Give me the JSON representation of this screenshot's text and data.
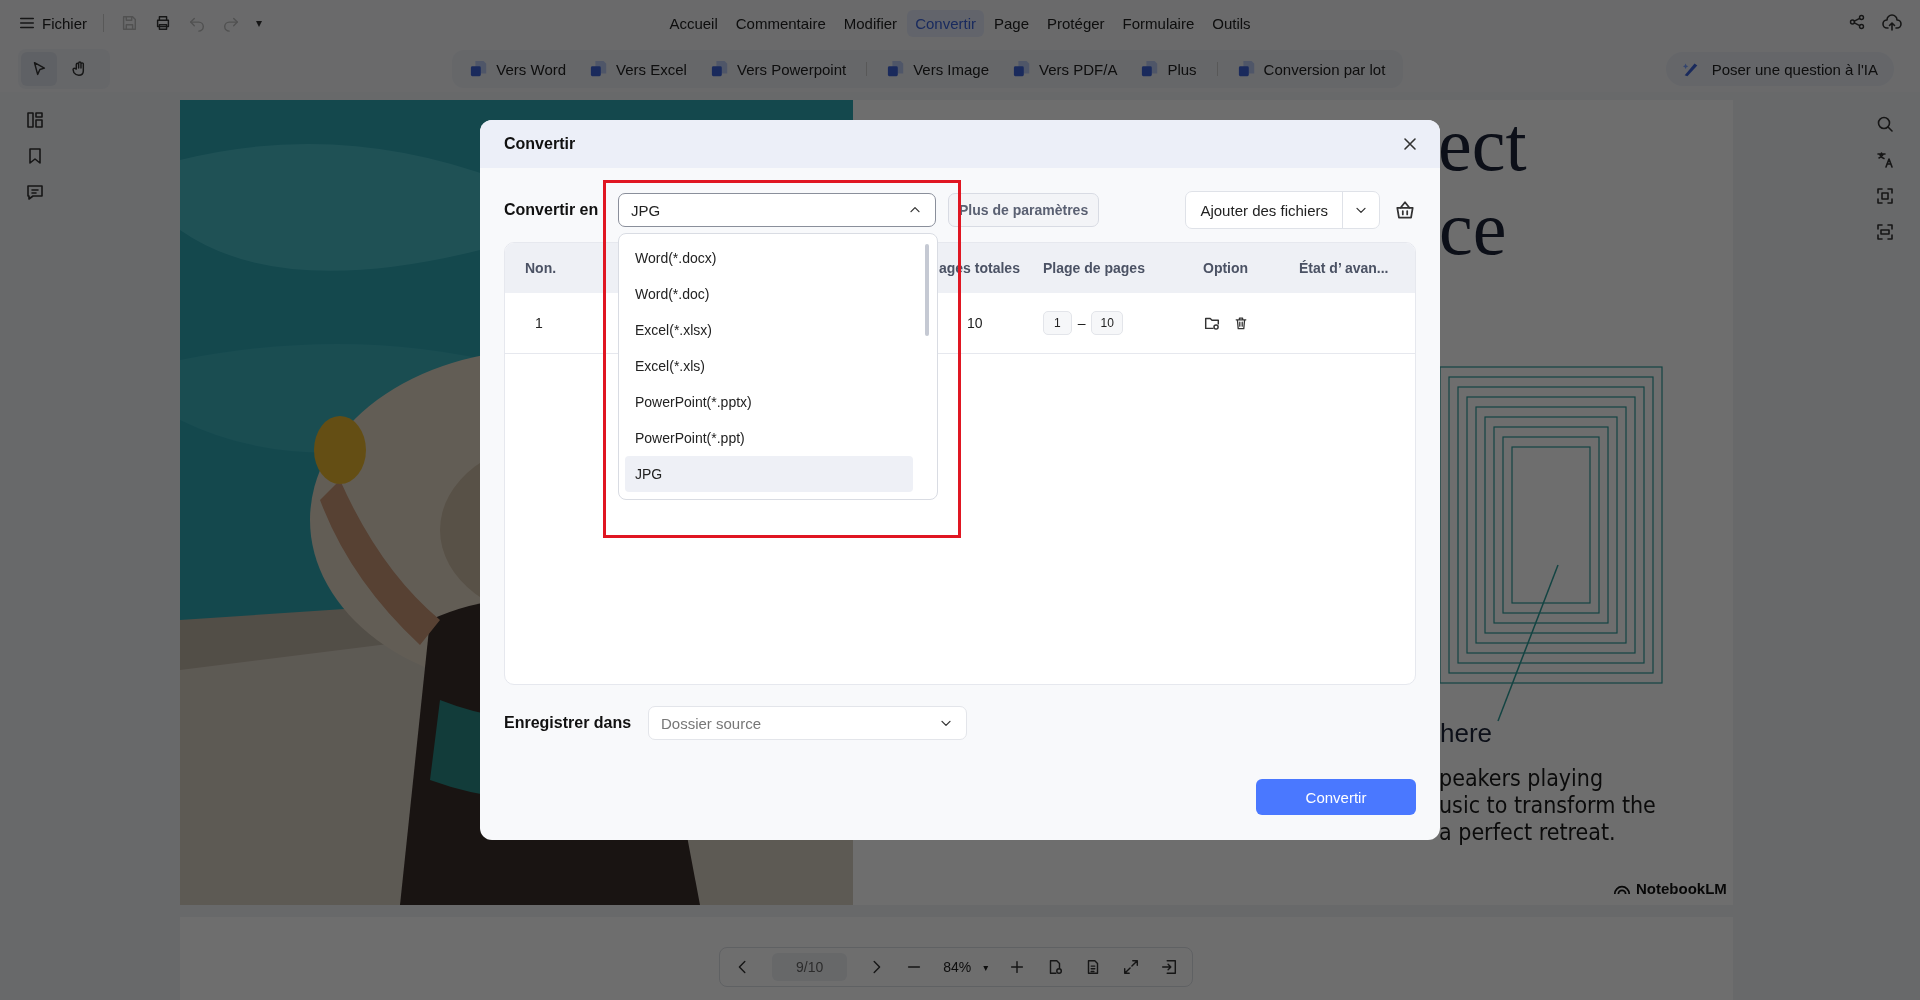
{
  "menu_bar": {
    "file_menu": "Fichier",
    "more_caret": "▾",
    "tabs": [
      {
        "label": "Accueil",
        "selected": false
      },
      {
        "label": "Commentaire",
        "selected": false
      },
      {
        "label": "Modifier",
        "selected": false
      },
      {
        "label": "Convertir",
        "selected": true
      },
      {
        "label": "Page",
        "selected": false
      },
      {
        "label": "Protéger",
        "selected": false
      },
      {
        "label": "Formulaire",
        "selected": false
      },
      {
        "label": "Outils",
        "selected": false
      }
    ]
  },
  "toolbar": {
    "conversions": [
      {
        "label": "Vers Word",
        "group_end": false
      },
      {
        "label": "Vers Excel",
        "group_end": false
      },
      {
        "label": "Vers Powerpoint",
        "group_end": true
      },
      {
        "label": "Vers Image",
        "group_end": false
      },
      {
        "label": "Vers PDF/A",
        "group_end": false
      },
      {
        "label": "Plus",
        "group_end": true
      },
      {
        "label": "Conversion par lot",
        "group_end": false
      }
    ],
    "ai_button": "Poser une question à l'IA"
  },
  "document": {
    "photo": {
      "kind": "picture"
    },
    "heading_fragments": [
      "ect",
      "ce"
    ],
    "subheading": "here",
    "body_lines": [
      "peakers playing",
      "usic to transform the",
      "a perfect retreat."
    ],
    "brand": "NotebookLM"
  },
  "pager": {
    "page": "9/10",
    "zoom": "84%",
    "zoom_caret": "▾"
  },
  "dialog": {
    "title": "Convertir",
    "convert_to_label": "Convertir en",
    "format_select": {
      "value": "JPG",
      "expanded": true
    },
    "format_options": [
      {
        "label": "Word(*.docx)",
        "selected": false
      },
      {
        "label": "Word(*.doc)",
        "selected": false
      },
      {
        "label": "Excel(*.xlsx)",
        "selected": false
      },
      {
        "label": "Excel(*.xls)",
        "selected": false
      },
      {
        "label": "PowerPoint(*.pptx)",
        "selected": false
      },
      {
        "label": "PowerPoint(*.ppt)",
        "selected": false
      },
      {
        "label": "JPG",
        "selected": true
      }
    ],
    "more_settings": "Plus de paramètres",
    "add_files": "Ajouter des fichiers",
    "table": {
      "columns": [
        "Non.",
        "ages totales",
        "Plage de pages",
        "Option",
        "État d’ avan..."
      ],
      "rows": [
        {
          "number": "1",
          "total_pages": "10",
          "range_from": "1",
          "range_separator": "–",
          "range_to": "10"
        }
      ]
    },
    "save_label": "Enregistrer dans",
    "save_select": {
      "value": "Dossier source"
    },
    "convert_button": "Convertir"
  }
}
